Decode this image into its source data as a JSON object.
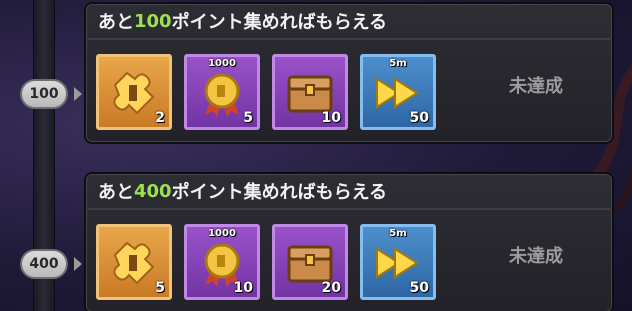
{
  "rewards": [
    {
      "threshold": "100",
      "heading_prefix": "あと",
      "heading_points": "100",
      "heading_suffix": "ポイント集めればもらえる",
      "status": "未達成",
      "items": [
        {
          "icon": "puzzle-piece-icon",
          "frame": "gold",
          "quantity": "2",
          "label": ""
        },
        {
          "icon": "gold-medal-icon",
          "frame": "purple",
          "quantity": "5",
          "label": "1000"
        },
        {
          "icon": "treasure-chest-icon",
          "frame": "purple",
          "quantity": "10",
          "label": ""
        },
        {
          "icon": "fast-forward-icon",
          "frame": "blue",
          "quantity": "50",
          "label": "5m"
        }
      ]
    },
    {
      "threshold": "400",
      "heading_prefix": "あと",
      "heading_points": "400",
      "heading_suffix": "ポイント集めればもらえる",
      "status": "未達成",
      "items": [
        {
          "icon": "puzzle-piece-icon",
          "frame": "gold",
          "quantity": "5",
          "label": ""
        },
        {
          "icon": "gold-medal-icon",
          "frame": "purple",
          "quantity": "10",
          "label": "1000"
        },
        {
          "icon": "treasure-chest-icon",
          "frame": "purple",
          "quantity": "20",
          "label": ""
        },
        {
          "icon": "fast-forward-icon",
          "frame": "blue",
          "quantity": "50",
          "label": "5m"
        }
      ]
    }
  ],
  "colors": {
    "highlight_points": "#9be04e",
    "status_text": "#9c9c9c",
    "gold_frame": "#e9a64a",
    "purple_frame": "#9a52c9",
    "blue_frame": "#4c8fcc"
  }
}
